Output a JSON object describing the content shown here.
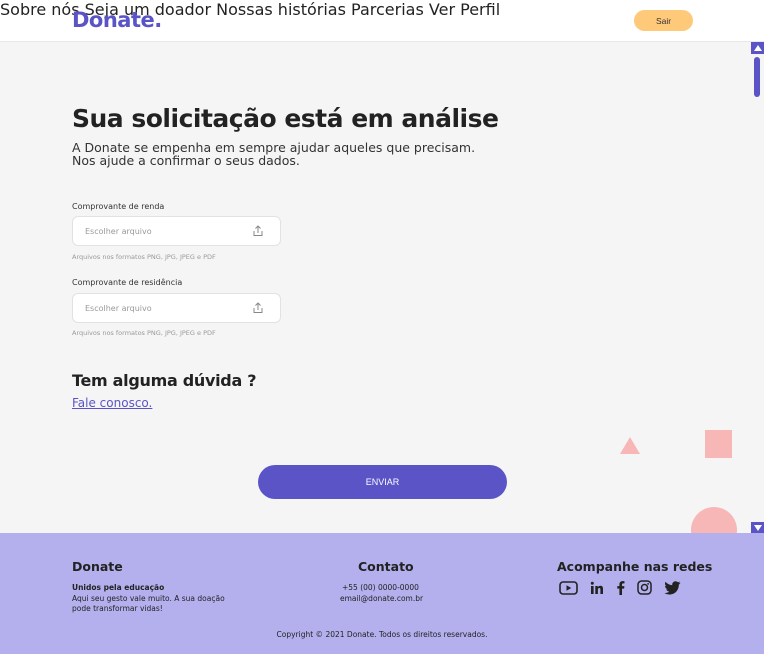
{
  "brand": {
    "logo_text": "Donate."
  },
  "nav": {
    "items": [
      "Sobre nós",
      "Seja um doador",
      "Nossas histórias",
      "Parcerias",
      "Ver Perfil"
    ],
    "logout_label": "Sair"
  },
  "main": {
    "title": "Sua solicitação está em análise",
    "subtitle_line1": "A Donate se empenha em sempre ajudar aqueles que precisam.",
    "subtitle_line2": "Nos ajude a confirmar o seus dados.",
    "fields": [
      {
        "label": "Comprovante de renda",
        "placeholder": "Escolher arquivo",
        "hint": "Arquivos  nos formatos PNG, JPG, JPEG e PDF",
        "icon": "upload-icon"
      },
      {
        "label": "Comprovante de residência",
        "placeholder": "Escolher arquivo",
        "hint": "Arquivos  nos formatos PNG, JPG, JPEG e PDF",
        "icon": "upload-icon"
      }
    ],
    "question": "Tem alguma dúvida ?",
    "contact_link": "Fale conosco.",
    "submit_label": "ENVIAR"
  },
  "footer": {
    "brand_title": "Donate",
    "tagline": "Unidos pela educação",
    "description_line1": "Aqui seu gesto vale muito. A sua doação",
    "description_line2": "pode transformar vidas!",
    "contact_title": "Contato",
    "phone": "+55 (00) 0000-0000",
    "email": "email@donate.com.br",
    "social_title": "Acompanhe nas redes",
    "social_icons": [
      "youtube-icon",
      "linkedin-icon",
      "facebook-icon",
      "instagram-icon",
      "twitter-icon"
    ],
    "copyright": "Copyright © 2021 Donate. Todos os direitos reservados."
  },
  "colors": {
    "primary": "#5b54c7",
    "accent": "#ffc97a",
    "footer_bg": "#b4b0ee",
    "decor": "#f7b7b7",
    "page_bg": "#f5f5f5"
  }
}
